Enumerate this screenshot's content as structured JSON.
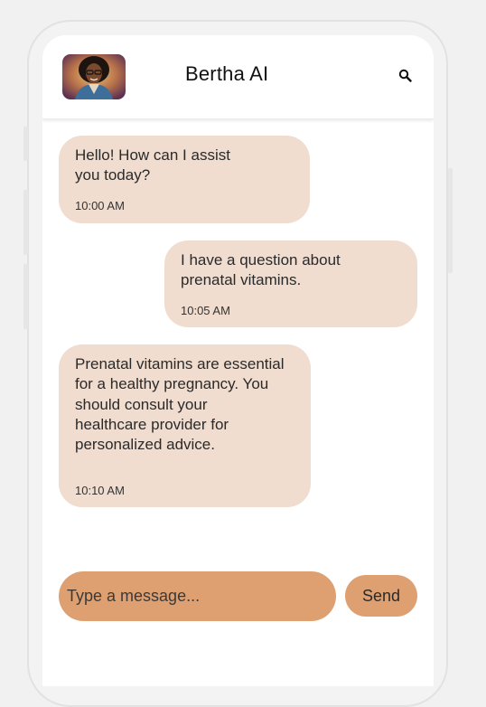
{
  "header": {
    "title": "Bertha AI",
    "avatar_icon": "assistant-portrait-avatar",
    "search_icon": "search-icon"
  },
  "messages": [
    {
      "sender": "assistant",
      "text": "Hello! How can I assist\nyou today?",
      "time": "10:00 AM"
    },
    {
      "sender": "user",
      "text": "I have a question about\nprenatal vitamins.",
      "time": "10:05 AM"
    },
    {
      "sender": "assistant",
      "text": "Prenatal vitamins are essential\nfor a healthy pregnancy. You\nshould consult your\nhealthcare provider for\npersonalized advice.",
      "time": "10:10 AM"
    }
  ],
  "composer": {
    "placeholder": "Type a message...",
    "send_label": "Send"
  },
  "colors": {
    "bubble": "#f0ddcf",
    "accent": "#dea071",
    "background": "#f1f1f1"
  }
}
